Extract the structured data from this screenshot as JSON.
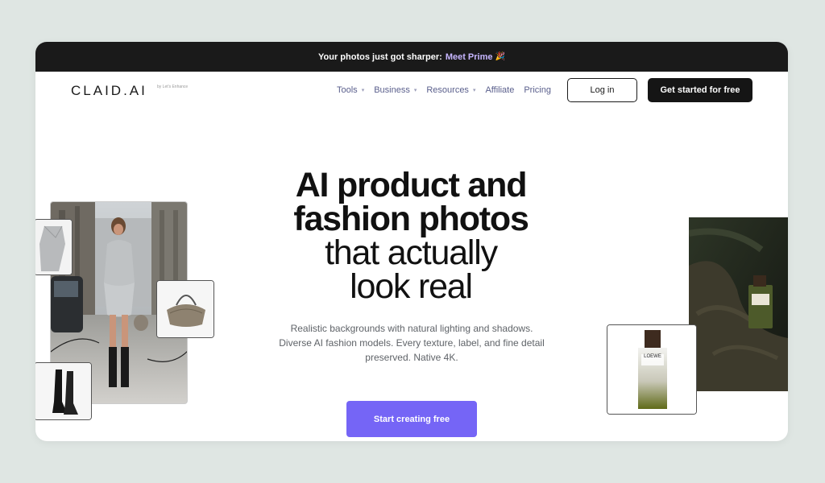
{
  "announcement": {
    "text": "Your photos just got sharper:",
    "link": "Meet Prime",
    "emoji": "🎉"
  },
  "brand": {
    "logo": "CLAID.AI",
    "sub": "by Let's Enhance"
  },
  "nav": {
    "items": [
      {
        "label": "Tools",
        "has_dropdown": true
      },
      {
        "label": "Business",
        "has_dropdown": true
      },
      {
        "label": "Resources",
        "has_dropdown": true
      },
      {
        "label": "Affiliate",
        "has_dropdown": false
      },
      {
        "label": "Pricing",
        "has_dropdown": false
      }
    ],
    "login": "Log in",
    "get_started": "Get started for free"
  },
  "hero": {
    "line1": "AI product and",
    "line2": "fashion photos",
    "line3": "that actually",
    "line4": "look real",
    "subtext": "Realistic backgrounds with natural lighting and shadows. Diverse AI fashion models. Every texture, label, and fine detail preserved. Native 4K.",
    "cta": "Start creating free"
  },
  "product": {
    "label": "LOEWE"
  },
  "colors": {
    "accent": "#7565f6",
    "dark": "#151515",
    "nav_text": "#5a5f8c",
    "background": "#dfe6e3"
  }
}
